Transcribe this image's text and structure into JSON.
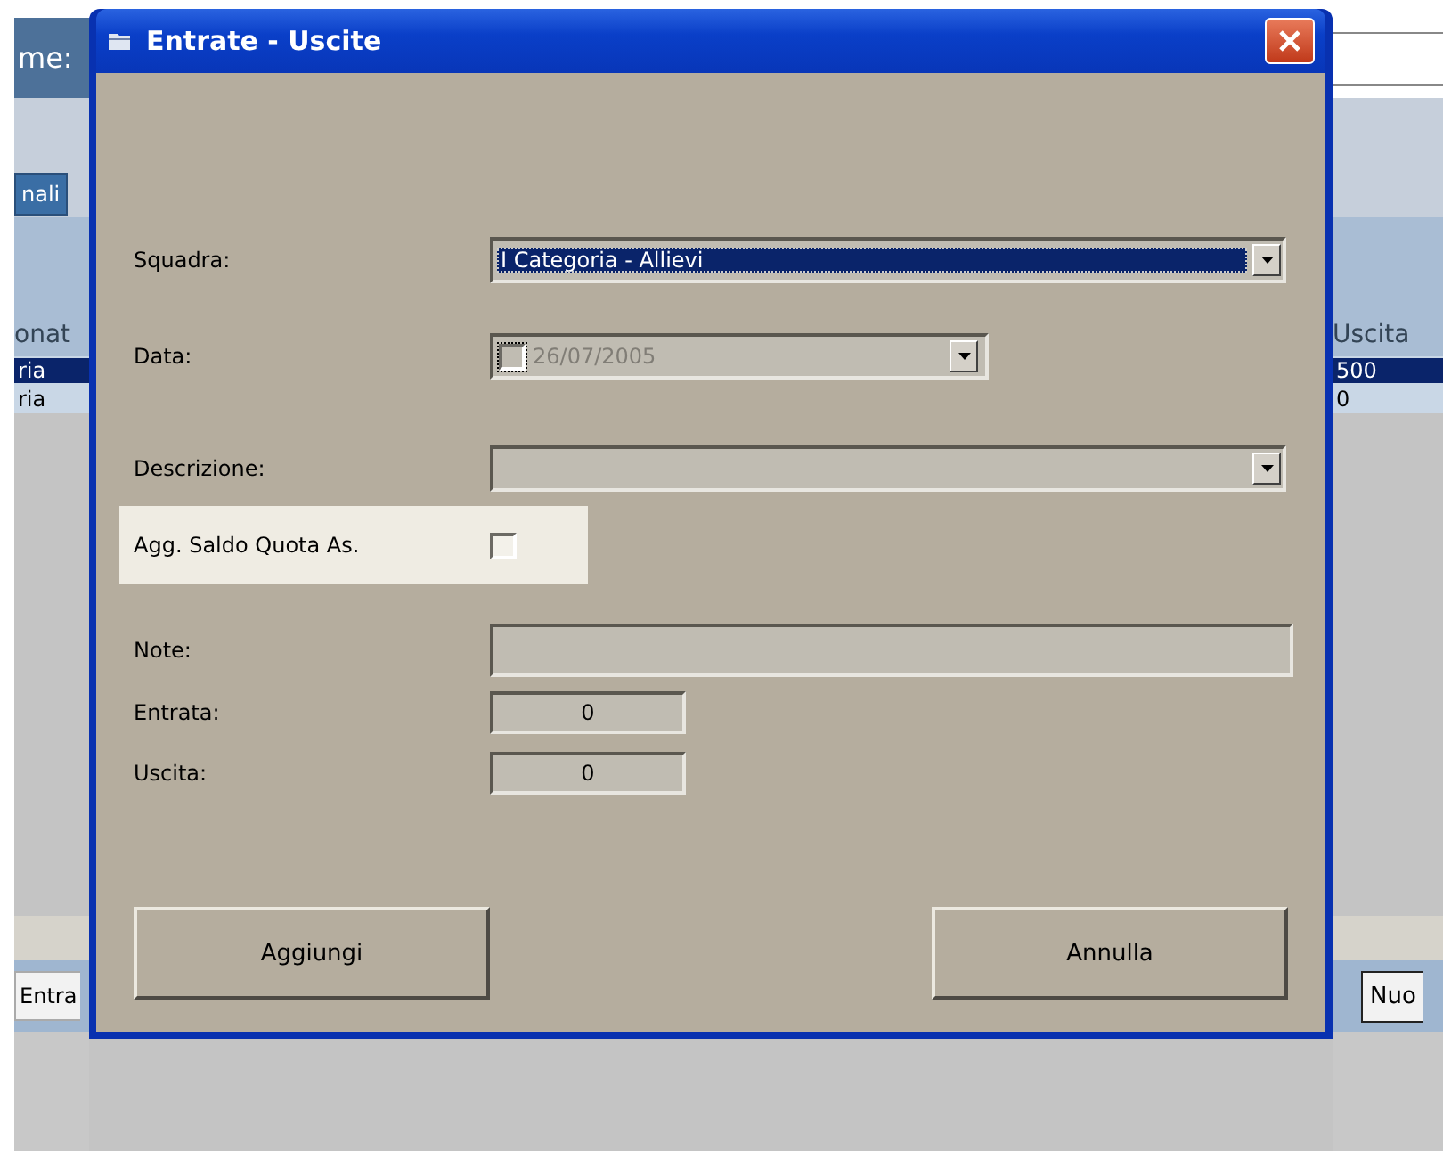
{
  "background": {
    "left": {
      "field_label": "me:",
      "tab": "nali",
      "column_header": "onat",
      "rows": [
        {
          "text": "ria",
          "selected": true
        },
        {
          "text": "ria",
          "selected": false
        }
      ],
      "button": "Entra"
    },
    "right": {
      "column_header": "Uscita",
      "rows": [
        {
          "text": "500",
          "selected": true
        },
        {
          "text": "0",
          "selected": false
        }
      ],
      "button": "Nuo"
    }
  },
  "dialog": {
    "title": "Entrate - Uscite",
    "fields": [
      {
        "kind": "combo",
        "label": "Squadra:",
        "value": "I Categoria - Allievi",
        "highlighted": true
      },
      {
        "kind": "date",
        "label": "Data:",
        "value": "26/07/2005",
        "checked": false,
        "disabled": true
      },
      {
        "kind": "combo",
        "label": "Descrizione:"
      },
      {
        "kind": "checkbox",
        "label": "Agg. Saldo Quota As.",
        "checked": false
      },
      {
        "kind": "text",
        "label": "Note:"
      },
      {
        "kind": "number",
        "label": "Entrata:",
        "value": "0"
      },
      {
        "kind": "number",
        "label": "Uscita:",
        "value": "0"
      }
    ],
    "buttons": [
      "Aggiungi",
      "Annulla"
    ]
  }
}
